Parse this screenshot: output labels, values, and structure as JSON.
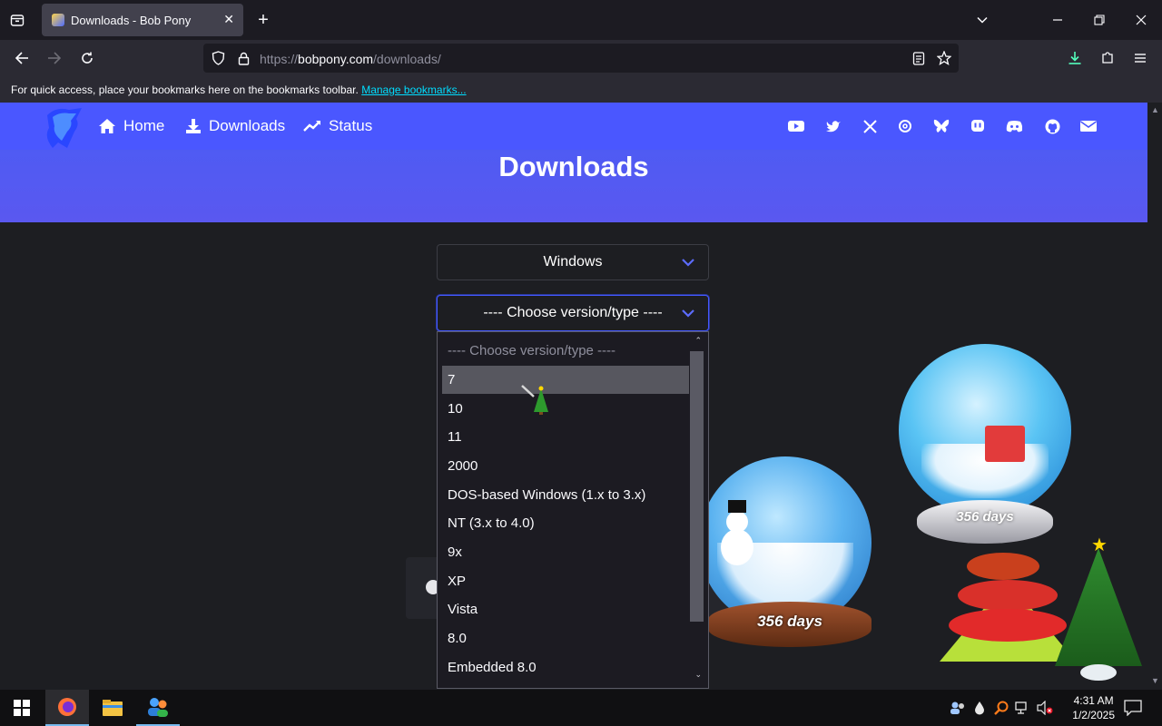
{
  "browser": {
    "tab_title": "Downloads - Bob Pony",
    "url_prefix": "https://",
    "url_host": "bobpony.com",
    "url_path": "/downloads/",
    "bookmarks_text": "For quick access, place your bookmarks here on the bookmarks toolbar.",
    "bookmarks_link": "Manage bookmarks..."
  },
  "site": {
    "nav": [
      {
        "label": "Home",
        "icon": "home-icon"
      },
      {
        "label": "Downloads",
        "icon": "download-icon"
      },
      {
        "label": "Status",
        "icon": "chart-line-icon"
      }
    ],
    "social_icons": [
      "youtube-icon",
      "twitter-icon",
      "x-icon",
      "threads-icon",
      "bluesky-icon",
      "mastodon-icon",
      "discord-icon",
      "github-icon",
      "email-icon"
    ],
    "page_title": "Downloads",
    "header_color": "#4a57ff"
  },
  "form": {
    "os_select": "Windows",
    "version_select": "---- Choose version/type ----"
  },
  "dropdown": {
    "options": [
      "---- Choose version/type ----",
      "7",
      "10",
      "11",
      "2000",
      "DOS-based Windows (1.x to 3.x)",
      "NT (3.x to 4.0)",
      "9x",
      "XP",
      "Vista",
      "8.0",
      "Embedded 8.0"
    ],
    "highlighted": "7"
  },
  "decor": {
    "globe_days_1": "356 days",
    "globe_days_2": "356 days"
  },
  "taskbar": {
    "time": "4:31 AM",
    "date": "1/2/2025"
  }
}
